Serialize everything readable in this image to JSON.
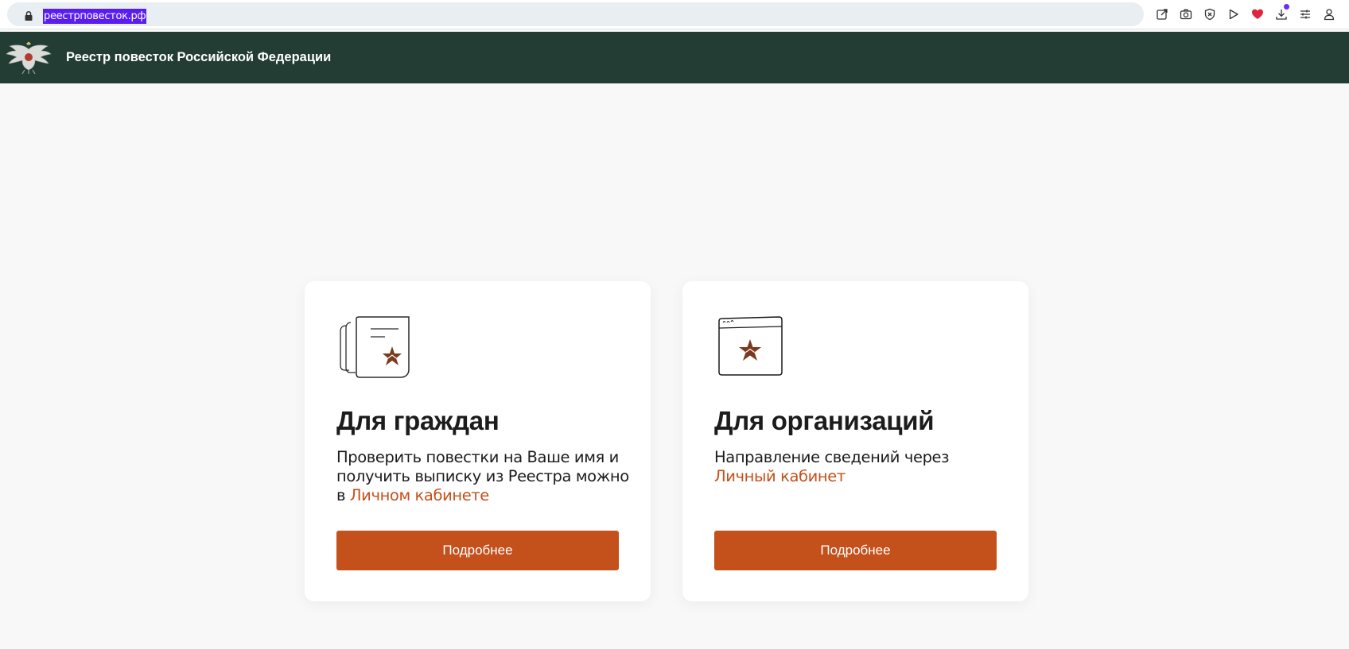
{
  "browser": {
    "url": "реестрповесток.рф",
    "toolbar_icons": [
      "share-icon",
      "camera-icon",
      "shield-icon",
      "play-icon",
      "heart-icon",
      "download-icon",
      "sliders-icon",
      "profile-icon"
    ]
  },
  "header": {
    "title": "Реестр повесток Российской Федерации",
    "background_color": "#233d35"
  },
  "cards": [
    {
      "title": "Для граждан",
      "text_before": "Проверить повестки на Ваше имя и получить выписку из Реестра можно в ",
      "link_text": "Личном кабинете",
      "button_label": "Подробнее"
    },
    {
      "title": "Для организаций",
      "text_before": "Направление сведений через ",
      "link_text": "Личный кабинет",
      "button_label": "Подробнее"
    }
  ],
  "colors": {
    "accent": "#c4501b",
    "star": "#7a3a1e",
    "page_background": "#f8f8f8",
    "url_selection": "#5a1df0"
  }
}
